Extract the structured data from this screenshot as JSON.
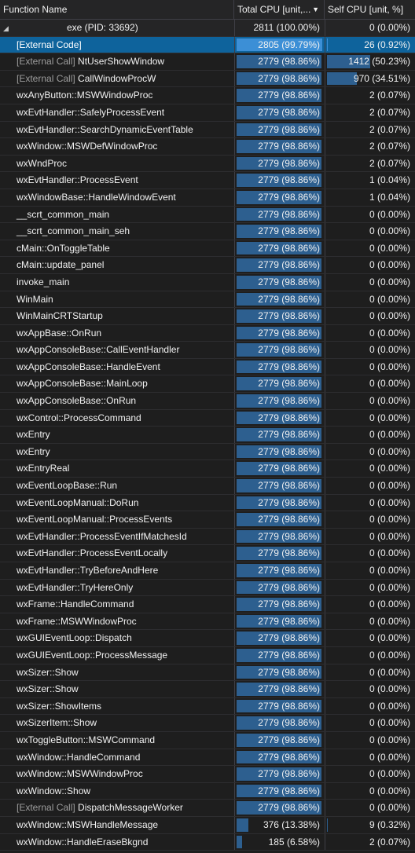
{
  "header": {
    "name_label": "Function Name",
    "total_label": "Total CPU [unit,...",
    "self_label": "Self CPU [unit, %]"
  },
  "rows": [
    {
      "name": "exe (PID: 33692)",
      "prefix": "",
      "total": "2811 (100.00%)",
      "total_pct": 0,
      "self": "0 (0.00%)",
      "self_pct": 0
    },
    {
      "name": "[External Code]",
      "prefix": "",
      "total": "2805 (99.79%)",
      "total_pct": 99.79,
      "self": "26 (0.92%)",
      "self_pct": 0.92
    },
    {
      "name": "NtUserShowWindow",
      "prefix": "[External Call]",
      "total": "2779 (98.86%)",
      "total_pct": 98.86,
      "self": "1412 (50.23%)",
      "self_pct": 50.23
    },
    {
      "name": "CallWindowProcW",
      "prefix": "[External Call]",
      "total": "2779 (98.86%)",
      "total_pct": 98.86,
      "self": "970 (34.51%)",
      "self_pct": 34.51
    },
    {
      "name": "wxAnyButton::MSWWindowProc",
      "prefix": "",
      "total": "2779 (98.86%)",
      "total_pct": 98.86,
      "self": "2 (0.07%)",
      "self_pct": 0.07
    },
    {
      "name": "wxEvtHandler::SafelyProcessEvent",
      "prefix": "",
      "total": "2779 (98.86%)",
      "total_pct": 98.86,
      "self": "2 (0.07%)",
      "self_pct": 0.07
    },
    {
      "name": "wxEvtHandler::SearchDynamicEventTable",
      "prefix": "",
      "total": "2779 (98.86%)",
      "total_pct": 98.86,
      "self": "2 (0.07%)",
      "self_pct": 0.07
    },
    {
      "name": "wxWindow::MSWDefWindowProc",
      "prefix": "",
      "total": "2779 (98.86%)",
      "total_pct": 98.86,
      "self": "2 (0.07%)",
      "self_pct": 0.07
    },
    {
      "name": "wxWndProc",
      "prefix": "",
      "total": "2779 (98.86%)",
      "total_pct": 98.86,
      "self": "2 (0.07%)",
      "self_pct": 0.07
    },
    {
      "name": "wxEvtHandler::ProcessEvent",
      "prefix": "",
      "total": "2779 (98.86%)",
      "total_pct": 98.86,
      "self": "1 (0.04%)",
      "self_pct": 0.04
    },
    {
      "name": "wxWindowBase::HandleWindowEvent",
      "prefix": "",
      "total": "2779 (98.86%)",
      "total_pct": 98.86,
      "self": "1 (0.04%)",
      "self_pct": 0.04
    },
    {
      "name": "__scrt_common_main",
      "prefix": "",
      "total": "2779 (98.86%)",
      "total_pct": 98.86,
      "self": "0 (0.00%)",
      "self_pct": 0
    },
    {
      "name": "__scrt_common_main_seh",
      "prefix": "",
      "total": "2779 (98.86%)",
      "total_pct": 98.86,
      "self": "0 (0.00%)",
      "self_pct": 0
    },
    {
      "name": "cMain::OnToggleTable",
      "prefix": "",
      "total": "2779 (98.86%)",
      "total_pct": 98.86,
      "self": "0 (0.00%)",
      "self_pct": 0
    },
    {
      "name": "cMain::update_panel",
      "prefix": "",
      "total": "2779 (98.86%)",
      "total_pct": 98.86,
      "self": "0 (0.00%)",
      "self_pct": 0
    },
    {
      "name": "invoke_main",
      "prefix": "",
      "total": "2779 (98.86%)",
      "total_pct": 98.86,
      "self": "0 (0.00%)",
      "self_pct": 0
    },
    {
      "name": "WinMain",
      "prefix": "",
      "total": "2779 (98.86%)",
      "total_pct": 98.86,
      "self": "0 (0.00%)",
      "self_pct": 0
    },
    {
      "name": "WinMainCRTStartup",
      "prefix": "",
      "total": "2779 (98.86%)",
      "total_pct": 98.86,
      "self": "0 (0.00%)",
      "self_pct": 0
    },
    {
      "name": "wxAppBase::OnRun",
      "prefix": "",
      "total": "2779 (98.86%)",
      "total_pct": 98.86,
      "self": "0 (0.00%)",
      "self_pct": 0
    },
    {
      "name": "wxAppConsoleBase::CallEventHandler",
      "prefix": "",
      "total": "2779 (98.86%)",
      "total_pct": 98.86,
      "self": "0 (0.00%)",
      "self_pct": 0
    },
    {
      "name": "wxAppConsoleBase::HandleEvent",
      "prefix": "",
      "total": "2779 (98.86%)",
      "total_pct": 98.86,
      "self": "0 (0.00%)",
      "self_pct": 0
    },
    {
      "name": "wxAppConsoleBase::MainLoop",
      "prefix": "",
      "total": "2779 (98.86%)",
      "total_pct": 98.86,
      "self": "0 (0.00%)",
      "self_pct": 0
    },
    {
      "name": "wxAppConsoleBase::OnRun",
      "prefix": "",
      "total": "2779 (98.86%)",
      "total_pct": 98.86,
      "self": "0 (0.00%)",
      "self_pct": 0
    },
    {
      "name": "wxControl::ProcessCommand",
      "prefix": "",
      "total": "2779 (98.86%)",
      "total_pct": 98.86,
      "self": "0 (0.00%)",
      "self_pct": 0
    },
    {
      "name": "wxEntry",
      "prefix": "",
      "total": "2779 (98.86%)",
      "total_pct": 98.86,
      "self": "0 (0.00%)",
      "self_pct": 0
    },
    {
      "name": "wxEntry",
      "prefix": "",
      "total": "2779 (98.86%)",
      "total_pct": 98.86,
      "self": "0 (0.00%)",
      "self_pct": 0
    },
    {
      "name": "wxEntryReal",
      "prefix": "",
      "total": "2779 (98.86%)",
      "total_pct": 98.86,
      "self": "0 (0.00%)",
      "self_pct": 0
    },
    {
      "name": "wxEventLoopBase::Run",
      "prefix": "",
      "total": "2779 (98.86%)",
      "total_pct": 98.86,
      "self": "0 (0.00%)",
      "self_pct": 0
    },
    {
      "name": "wxEventLoopManual::DoRun",
      "prefix": "",
      "total": "2779 (98.86%)",
      "total_pct": 98.86,
      "self": "0 (0.00%)",
      "self_pct": 0
    },
    {
      "name": "wxEventLoopManual::ProcessEvents",
      "prefix": "",
      "total": "2779 (98.86%)",
      "total_pct": 98.86,
      "self": "0 (0.00%)",
      "self_pct": 0
    },
    {
      "name": "wxEvtHandler::ProcessEventIfMatchesId",
      "prefix": "",
      "total": "2779 (98.86%)",
      "total_pct": 98.86,
      "self": "0 (0.00%)",
      "self_pct": 0
    },
    {
      "name": "wxEvtHandler::ProcessEventLocally",
      "prefix": "",
      "total": "2779 (98.86%)",
      "total_pct": 98.86,
      "self": "0 (0.00%)",
      "self_pct": 0
    },
    {
      "name": "wxEvtHandler::TryBeforeAndHere",
      "prefix": "",
      "total": "2779 (98.86%)",
      "total_pct": 98.86,
      "self": "0 (0.00%)",
      "self_pct": 0
    },
    {
      "name": "wxEvtHandler::TryHereOnly",
      "prefix": "",
      "total": "2779 (98.86%)",
      "total_pct": 98.86,
      "self": "0 (0.00%)",
      "self_pct": 0
    },
    {
      "name": "wxFrame::HandleCommand",
      "prefix": "",
      "total": "2779 (98.86%)",
      "total_pct": 98.86,
      "self": "0 (0.00%)",
      "self_pct": 0
    },
    {
      "name": "wxFrame::MSWWindowProc",
      "prefix": "",
      "total": "2779 (98.86%)",
      "total_pct": 98.86,
      "self": "0 (0.00%)",
      "self_pct": 0
    },
    {
      "name": "wxGUIEventLoop::Dispatch",
      "prefix": "",
      "total": "2779 (98.86%)",
      "total_pct": 98.86,
      "self": "0 (0.00%)",
      "self_pct": 0
    },
    {
      "name": "wxGUIEventLoop::ProcessMessage",
      "prefix": "",
      "total": "2779 (98.86%)",
      "total_pct": 98.86,
      "self": "0 (0.00%)",
      "self_pct": 0
    },
    {
      "name": "wxSizer::Show",
      "prefix": "",
      "total": "2779 (98.86%)",
      "total_pct": 98.86,
      "self": "0 (0.00%)",
      "self_pct": 0
    },
    {
      "name": "wxSizer::Show",
      "prefix": "",
      "total": "2779 (98.86%)",
      "total_pct": 98.86,
      "self": "0 (0.00%)",
      "self_pct": 0
    },
    {
      "name": "wxSizer::ShowItems",
      "prefix": "",
      "total": "2779 (98.86%)",
      "total_pct": 98.86,
      "self": "0 (0.00%)",
      "self_pct": 0
    },
    {
      "name": "wxSizerItem::Show",
      "prefix": "",
      "total": "2779 (98.86%)",
      "total_pct": 98.86,
      "self": "0 (0.00%)",
      "self_pct": 0
    },
    {
      "name": "wxToggleButton::MSWCommand",
      "prefix": "",
      "total": "2779 (98.86%)",
      "total_pct": 98.86,
      "self": "0 (0.00%)",
      "self_pct": 0
    },
    {
      "name": "wxWindow::HandleCommand",
      "prefix": "",
      "total": "2779 (98.86%)",
      "total_pct": 98.86,
      "self": "0 (0.00%)",
      "self_pct": 0
    },
    {
      "name": "wxWindow::MSWWindowProc",
      "prefix": "",
      "total": "2779 (98.86%)",
      "total_pct": 98.86,
      "self": "0 (0.00%)",
      "self_pct": 0
    },
    {
      "name": "wxWindow::Show",
      "prefix": "",
      "total": "2779 (98.86%)",
      "total_pct": 98.86,
      "self": "0 (0.00%)",
      "self_pct": 0
    },
    {
      "name": "DispatchMessageWorker",
      "prefix": "[External Call]",
      "total": "2779 (98.86%)",
      "total_pct": 98.86,
      "self": "0 (0.00%)",
      "self_pct": 0
    },
    {
      "name": "wxWindow::MSWHandleMessage",
      "prefix": "",
      "total": "376 (13.38%)",
      "total_pct": 13.38,
      "self": "9 (0.32%)",
      "self_pct": 0.32
    },
    {
      "name": "wxWindow::HandleEraseBkgnd",
      "prefix": "",
      "total": "185 (6.58%)",
      "total_pct": 6.58,
      "self": "2 (0.07%)",
      "self_pct": 0.07
    }
  ],
  "colors": {
    "background": "#1e1e1e",
    "selection": "#0e639c",
    "bar": "#2d5f8f",
    "selected_bar": "#3c8fd6"
  }
}
